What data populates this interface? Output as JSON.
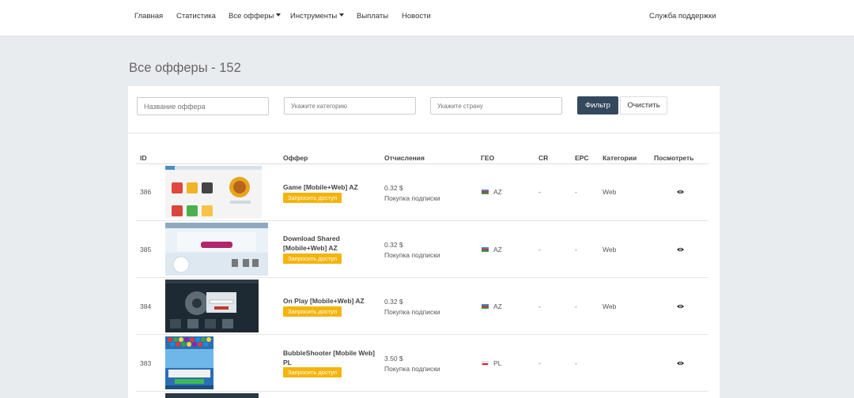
{
  "nav": {
    "items": [
      "Главная",
      "Статистика",
      "Все офферы",
      "Инструменты",
      "Выплаты",
      "Новости"
    ],
    "support": "Служба поддержки"
  },
  "page": {
    "title": "Все офферы - 152"
  },
  "filters": {
    "name_placeholder": "Название оффера",
    "category_placeholder": "Укажите категорию",
    "country_placeholder": "Укажите страну",
    "filter_button": "Фильтр",
    "clear_button": "Очистить"
  },
  "table": {
    "columns": [
      "ID",
      "Оффер",
      "Отчисления",
      "ГЕО",
      "CR",
      "EPC",
      "Категории",
      "Посмотреть"
    ],
    "request_label": "Запросить доступ",
    "rows": [
      {
        "id": "386",
        "offer": "Game [Mobile+Web] AZ",
        "amount": "0.32 $",
        "payout_type": "Покупка подписки",
        "geo": "AZ",
        "cr": "-",
        "epc": "-",
        "category": "Web"
      },
      {
        "id": "385",
        "offer": "Download Shared [Mobile+Web] AZ",
        "amount": "0.32 $",
        "payout_type": "Покупка подписки",
        "geo": "AZ",
        "cr": "-",
        "epc": "-",
        "category": "Web"
      },
      {
        "id": "384",
        "offer": "On Play [Mobile+Web] AZ",
        "amount": "0.32 $",
        "payout_type": "Покупка подписки",
        "geo": "AZ",
        "cr": "-",
        "epc": "-",
        "category": "Web"
      },
      {
        "id": "383",
        "offer": "BubbleShooter [Mobile Web] PL",
        "amount": "3.50 $",
        "payout_type": "Покупка подписки",
        "geo": "PL",
        "cr": "-",
        "epc": "-",
        "category": ""
      }
    ]
  },
  "colors": {
    "accent_dark": "#34495e",
    "request_button": "#f5b40c",
    "page_bg": "#e9ecef"
  },
  "icons": {
    "view": "eye-icon",
    "dropdown": "caret-down-icon"
  }
}
